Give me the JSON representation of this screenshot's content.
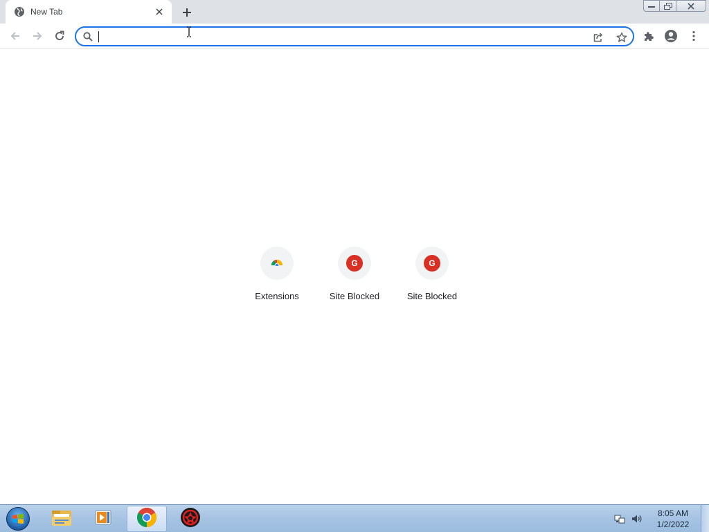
{
  "tab": {
    "title": "New Tab"
  },
  "omnibox": {
    "value": ""
  },
  "shortcuts": [
    {
      "label": "Extensions",
      "icon": "chrome-extensions-icon"
    },
    {
      "label": "Site Blocked",
      "icon": "site-blocked-favicon",
      "badge": "G"
    },
    {
      "label": "Site Blocked",
      "icon": "site-blocked-favicon",
      "badge": "G"
    }
  ],
  "taskbar": {
    "items": [
      "windows-explorer-icon",
      "media-player-icon",
      "chrome-icon",
      "security-app-icon"
    ],
    "active": "chrome-icon"
  },
  "clock": {
    "time": "8:05 AM",
    "date": "1/2/2022"
  },
  "colors": {
    "accent": "#1a73e8",
    "tabstrip": "#dee1e6",
    "blocked": "#d93025"
  }
}
